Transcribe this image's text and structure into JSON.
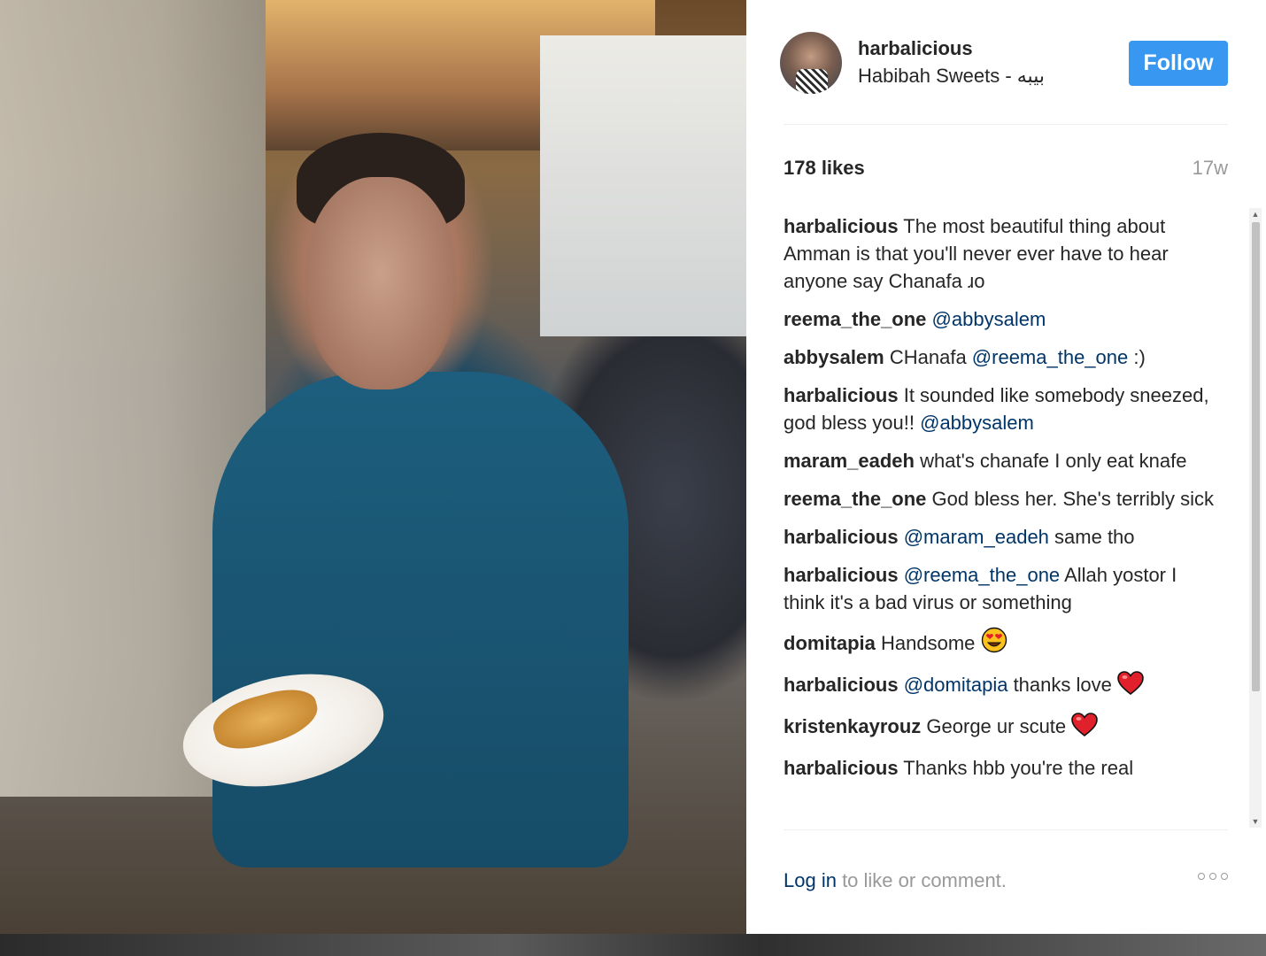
{
  "post": {
    "username": "harbalicious",
    "location": "Habibah Sweets - بيبه",
    "follow_label": "Follow",
    "likes": "178 likes",
    "age": "17w"
  },
  "comments": [
    {
      "user": "harbalicious",
      "segments": [
        {
          "text": " The most beautiful thing about Amman is that you'll never ever have to hear anyone say Chanafa ɹo",
          "mention": false
        }
      ]
    },
    {
      "user": "reema_the_one",
      "segments": [
        {
          "text": " ",
          "mention": false
        },
        {
          "text": "@abbysalem",
          "mention": true
        }
      ]
    },
    {
      "user": "abbysalem",
      "segments": [
        {
          "text": " CHanafa ",
          "mention": false
        },
        {
          "text": "@reema_the_one",
          "mention": true
        },
        {
          "text": " :)",
          "mention": false
        }
      ]
    },
    {
      "user": "harbalicious",
      "segments": [
        {
          "text": " It sounded like somebody sneezed, god bless you!! ",
          "mention": false
        },
        {
          "text": "@abbysalem",
          "mention": true
        }
      ]
    },
    {
      "user": "maram_eadeh",
      "segments": [
        {
          "text": " what's chanafe I only eat knafe",
          "mention": false
        }
      ]
    },
    {
      "user": "reema_the_one",
      "segments": [
        {
          "text": " God bless her. She's terribly sick",
          "mention": false
        }
      ]
    },
    {
      "user": "harbalicious",
      "segments": [
        {
          "text": " ",
          "mention": false
        },
        {
          "text": "@maram_eadeh",
          "mention": true
        },
        {
          "text": " same tho",
          "mention": false
        }
      ]
    },
    {
      "user": "harbalicious",
      "segments": [
        {
          "text": " ",
          "mention": false
        },
        {
          "text": "@reema_the_one",
          "mention": true
        },
        {
          "text": " Allah yostor I think it's a bad virus or something",
          "mention": false
        }
      ]
    },
    {
      "user": "domitapia",
      "segments": [
        {
          "text": " Handsome ",
          "mention": false
        }
      ],
      "emoji": "heart-eyes"
    },
    {
      "user": "harbalicious",
      "segments": [
        {
          "text": " ",
          "mention": false
        },
        {
          "text": "@domitapia",
          "mention": true
        },
        {
          "text": " thanks love ",
          "mention": false
        }
      ],
      "emoji": "heart"
    },
    {
      "user": "kristenkayrouz",
      "segments": [
        {
          "text": " George ur scute ",
          "mention": false
        }
      ],
      "emoji": "heart"
    },
    {
      "user": "harbalicious",
      "segments": [
        {
          "text": " Thanks hbb you're the real",
          "mention": false
        }
      ]
    }
  ],
  "footer": {
    "login_link": "Log in",
    "login_rest": " to like or comment."
  },
  "icons": {
    "more": "more-options-icon",
    "heart": "red-heart-emoji",
    "heart_eyes": "heart-eyes-emoji"
  },
  "colors": {
    "follow_button": "#3897f0",
    "mention": "#003569",
    "muted": "#999999"
  }
}
